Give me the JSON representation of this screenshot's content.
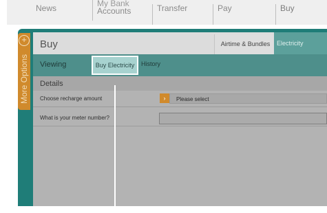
{
  "topnav": {
    "items": [
      {
        "label": "News"
      },
      {
        "label_line1": "My Bank",
        "label_line2": "Accounts"
      },
      {
        "label": "Transfer"
      },
      {
        "label": "Pay"
      },
      {
        "label": "Buy"
      }
    ]
  },
  "sidebar": {
    "more_options_label": "More Options",
    "expand_icon": "plus-circle-icon"
  },
  "panel": {
    "title": "Buy",
    "tabs": [
      {
        "label": "Airtime & Bundles"
      },
      {
        "label": "Electricity",
        "active": true
      }
    ],
    "viewing": {
      "label": "Viewing",
      "buttons": [
        {
          "label": "Buy Electricity",
          "highlighted": true
        },
        {
          "label": "History"
        }
      ]
    },
    "details": {
      "title": "Details",
      "fields": [
        {
          "label": "Choose recharge amount",
          "value": "Please select",
          "type": "select"
        },
        {
          "label": "What is your meter number?",
          "value": "",
          "type": "text"
        }
      ]
    }
  },
  "colors": {
    "teal": "#1f7d78",
    "orange": "#d08a2c",
    "viewing_bar": "#4e8f8b",
    "highlight": "#a7d2cf"
  }
}
